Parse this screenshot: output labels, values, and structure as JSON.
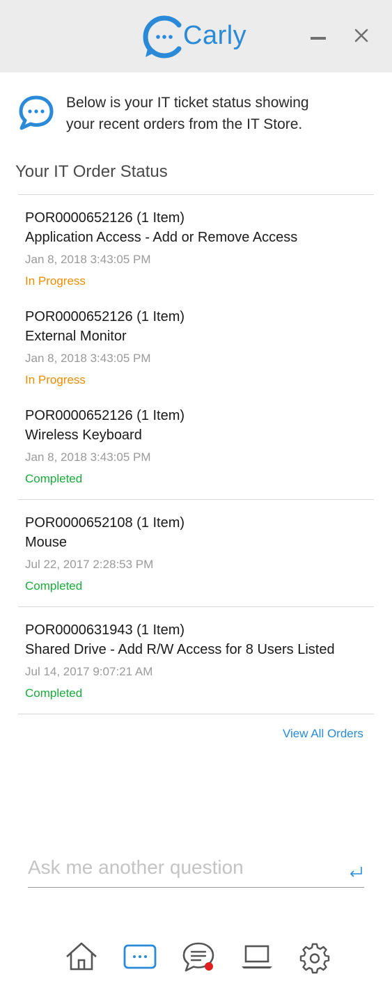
{
  "app": {
    "logo_text": "Carly"
  },
  "window": {
    "minimize_icon": "minimize-icon",
    "close_icon": "close-icon"
  },
  "intro": {
    "icon": "chat-bubble-icon",
    "line1": "Below is your IT ticket status showing",
    "line2": "your recent orders from the IT Store."
  },
  "section": {
    "title": "Your IT Order Status"
  },
  "orders": [
    {
      "number": "POR0000652126 (1 Item)",
      "name": "Application Access - Add or Remove Access",
      "date": "Jan 8, 2018 3:43:05 PM",
      "status": "In Progress"
    },
    {
      "number": "POR0000652126 (1 Item)",
      "name": "External Monitor",
      "date": "Jan 8, 2018 3:43:05 PM",
      "status": "In Progress"
    },
    {
      "number": "POR0000652126 (1 Item)",
      "name": "Wireless Keyboard",
      "date": "Jan 8, 2018 3:43:05 PM",
      "status": "Completed"
    },
    {
      "number": "POR0000652108 (1 Item)",
      "name": "Mouse",
      "date": "Jul 22, 2017 2:28:53 PM",
      "status": "Completed"
    },
    {
      "number": "POR0000631943 (1 Item)",
      "name": "Shared Drive - Add R/W Access for 8 Users Listed",
      "date": "Jul 14, 2017 9:07:21 AM",
      "status": "Completed"
    }
  ],
  "view_all": "View All Orders",
  "ask": {
    "placeholder": "Ask me another question",
    "value": ""
  },
  "nav": {
    "items": [
      "home-icon",
      "chat-icon",
      "messages-icon",
      "laptop-icon",
      "settings-icon"
    ],
    "active": "chat-icon",
    "notification_color": "#e02020"
  },
  "colors": {
    "accent": "#2a8ad8",
    "in_progress": "#ef8c00",
    "completed": "#1aab3b"
  }
}
